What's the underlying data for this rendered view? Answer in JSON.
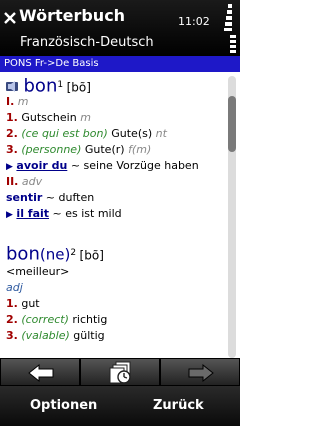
{
  "status_bar": {
    "time": "11:02"
  },
  "header": {
    "title": "Wörterbuch",
    "subtitle": "Französisch-Deutsch"
  },
  "dictionary": {
    "name": "PONS Fr->De Basis"
  },
  "entry1": {
    "headword": "bon",
    "homograph": "1",
    "phonetic": "[bõ]",
    "sec1_label": "I.",
    "sec1_pos": "m",
    "s1_num": "1.",
    "s1_text": "Gutschein",
    "s1_gender": "m",
    "s2_num": "2.",
    "s2_ctx": "(ce qui est bon)",
    "s2_text": "Gute(s)",
    "s2_gender": "nt",
    "s3_num": "3.",
    "s3_ctx": "(personne)",
    "s3_text": "Gute(r)",
    "s3_gender": "f(m)",
    "p1_phrase": "avoir du",
    "p1_trans": "~ seine Vorzüge haben",
    "sec2_label": "II.",
    "sec2_pos": "adv",
    "p2_word": "sentir",
    "p2_trans": "~ duften",
    "p3_phrase": "il fait",
    "p3_trans": "~ es ist mild"
  },
  "entry2": {
    "headword_base": "bon",
    "headword_suffix": "(ne)",
    "homograph": "2",
    "phonetic": "[bõ]",
    "comparative": "<meilleur>",
    "pos": "adj",
    "s1_num": "1.",
    "s1_text": "gut",
    "s2_num": "2.",
    "s2_ctx": "(correct)",
    "s2_text": "richtig",
    "s3_num": "3.",
    "s3_ctx": "(valable)",
    "s3_text": "gültig"
  },
  "softkeys": {
    "left": "Optionen",
    "right": "Zurück"
  },
  "icons": {
    "close": "close-icon",
    "speaker": "speaker-icon",
    "back": "back-arrow-icon",
    "history": "history-icon",
    "forward": "forward-arrow-icon"
  },
  "colors": {
    "dict_band": "#1e18c8",
    "headword": "#00008a",
    "sense_number": "#a00000",
    "context": "#2f8a2f"
  }
}
